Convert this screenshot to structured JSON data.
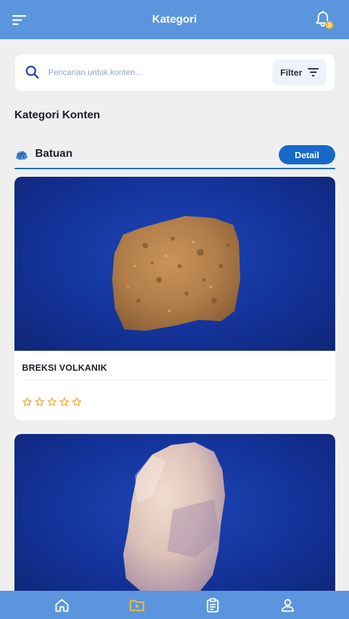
{
  "header": {
    "title": "Kategori",
    "menu_icon": "menu-icon",
    "notification_icon": "bell-icon",
    "notification_count": "0"
  },
  "search": {
    "placeholder": "Pencarian untuk konten...",
    "value": "",
    "filter_label": "Filter"
  },
  "section": {
    "title": "Kategori Konten"
  },
  "category": {
    "name": "Batuan",
    "icon": "rock-icon",
    "detail_label": "Detail"
  },
  "cards": [
    {
      "title": "BREKSI VOLKANIK",
      "rating": 0,
      "max_rating": 5
    },
    {
      "title": ""
    }
  ],
  "bottom_nav": {
    "items": [
      "home-icon",
      "category-folder-icon",
      "clipboard-icon",
      "profile-icon"
    ],
    "active": 1
  },
  "colors": {
    "primary": "#5b95dd",
    "accent": "#1769c9",
    "active_nav": "#f6c12f",
    "star": "#f0a43a"
  }
}
